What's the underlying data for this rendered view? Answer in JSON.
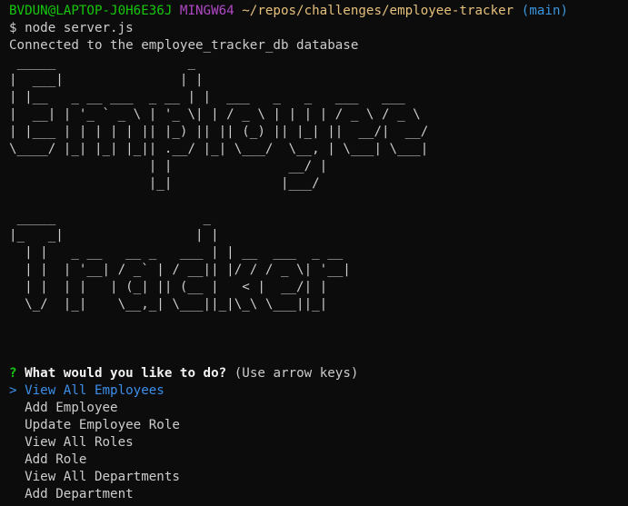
{
  "prompt": {
    "user_host": "BVDUN@LAPTOP-J0H6E36J",
    "shell": "MINGW64",
    "path": "~/repos/challenges/employee-tracker",
    "branch": "(main)"
  },
  "command": "$ node server.js",
  "connection_message": "Connected to the employee_tracker_db database",
  "banner": {
    "employee": " _____                 _\n|  ___|               | |\n| |__   _ __ ___  _ __ | |  ___   _   _   ___   ___\n|  __| | '_ ` _ \\ | '_ \\| | / _ \\ | | | | / _ \\ / _ \\\n| |___ | | | | | || |_) || || (_) || |_| ||  __/|  __/\n\\____/ |_| |_| |_|| .__/ |_| \\___/  \\__, | \\___| \\___|\n                  | |               __/ |\n                  |_|              |___/",
    "tracker": " _____                   _\n|_   _|                 | |\n  | |   _ __   __ _   ___ | | __  ___  _ __\n  | |  | '__| / _` | / __|| |/ / / _ \\| '__|\n  | |  | |   | (_| || (__ |   < |  __/| |\n  \\_/  |_|    \\__,_| \\___||_|\\_\\ \\___||_|"
  },
  "question": {
    "mark": "?",
    "text": "What would you like to do?",
    "hint": "(Use arrow keys)"
  },
  "menu": {
    "pointer": ">",
    "selected": "View All Employees",
    "options": [
      "Add Employee",
      "Update Employee Role",
      "View All Roles",
      "Add Role",
      "View All Departments",
      "Add Department"
    ]
  },
  "colors": {
    "background": "#0c0c0c",
    "text": "#cccccc",
    "user_host": "#16c60c",
    "shell": "#b148c6",
    "path": "#e5c07b",
    "branch": "#3a96dd",
    "selected": "#3b8eea"
  }
}
